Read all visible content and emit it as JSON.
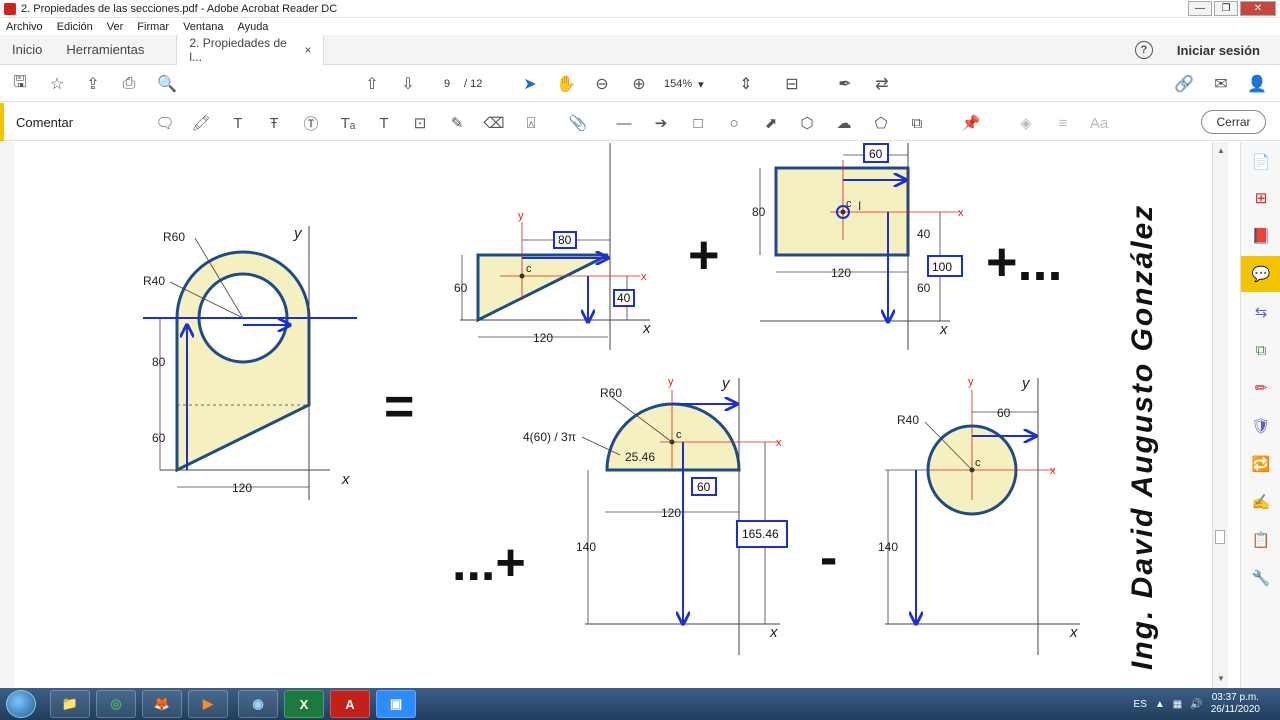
{
  "window": {
    "title": "2. Propiedades de las secciones.pdf - Adobe Acrobat Reader DC",
    "min": "—",
    "max": "❐",
    "close": "✕"
  },
  "menu": [
    "Archivo",
    "Edición",
    "Ver",
    "Firmar",
    "Ventana",
    "Ayuda"
  ],
  "tabs": {
    "home": "Inicio",
    "tools": "Herramientas",
    "document": "2. Propiedades de l...",
    "document_close": "×"
  },
  "header": {
    "signin": "Iniciar sesión",
    "help": "?"
  },
  "toolbar": {
    "page_current": "9",
    "page_total": "/ 12",
    "zoom": "154%",
    "zoom_caret": "▾",
    "icons": {
      "save": "🖫",
      "bookmark": "☆",
      "upload": "⇪",
      "print": "⎙",
      "search": "🔍",
      "prev_page": "⇧",
      "next_page": "⇩",
      "select": "➤",
      "hand": "✋",
      "zoom_out": "⊖",
      "zoom_in": "⊕",
      "fit": "⇕",
      "scroll_mode": "⊟",
      "sign": "✒",
      "share": "⇄",
      "link": "🔗",
      "mail": "✉",
      "user": "👤"
    }
  },
  "comment_bar": {
    "label": "Comentar",
    "close": "Cerrar",
    "icons": {
      "note": "🗨",
      "highlight": "🖍",
      "text": "T",
      "strike": "Ŧ",
      "replace": "Ⓣ",
      "insert": "Tₐ",
      "add_text": "T",
      "textbox": "⊡",
      "pencil": "✎",
      "eraser": "⌫",
      "stamp": "⍓",
      "attach": "📎",
      "line": "—",
      "arrow": "➔",
      "rect": "□",
      "oval": "○",
      "callout": "⬈",
      "polygon": "⬡",
      "cloud": "☁",
      "polyline": "⬠",
      "group": "⧉",
      "pin": "📌",
      "fill": "◈",
      "lines": "≡",
      "font": "Aa"
    }
  },
  "drawing": {
    "left_figure": {
      "r60": "R60",
      "r40": "R40",
      "dim80": "80",
      "dim60": "60",
      "dim120": "120",
      "y": "y",
      "x": "x"
    },
    "equals": "=",
    "triangle": {
      "y": "y",
      "c": "c",
      "x": "x",
      "dim80": "80",
      "dim40": "40",
      "dim60": "60",
      "dim120": "120",
      "xaxis": "x"
    },
    "plus1": "+",
    "rect": {
      "dim60": "60",
      "c": "c",
      "cursor": "I",
      "x": "x",
      "dim80": "80",
      "dim40": "40",
      "dim100": "100",
      "dim120": "120",
      "dim60b": "60",
      "xaxis": "x"
    },
    "plus_dots": "+...",
    "semicircle": {
      "r60": "R60",
      "y": "y",
      "yaxis": "y",
      "formula": "4(60) / 3π",
      "c": "c",
      "x": "x",
      "d2546": "25.46",
      "dim60": "60",
      "dim120": "120",
      "dim140": "140",
      "d16546": "165.46",
      "xaxis": "x"
    },
    "dots_plus": "...+",
    "minus": "-",
    "circle": {
      "y": "y",
      "yaxis": "y",
      "r40": "R40",
      "dim60": "60",
      "c": "c",
      "x": "x",
      "dim140": "140",
      "xaxis": "x"
    },
    "author": "Ing. David Augusto González"
  },
  "colors": {
    "fill": "#f5f0c0",
    "outline": "#1d4c8a",
    "arrow": "#1a2fd6",
    "axis_red": "#e0201c",
    "accent": "#f5c400"
  },
  "right_panel": {
    "icons": [
      "📄",
      "⊞",
      "📕",
      "💬",
      "⇆",
      "⧉",
      "✏",
      "🛡",
      "🔁",
      "✍",
      "📋",
      "🔧"
    ]
  },
  "taskbar": {
    "apps": {
      "explorer": "📁",
      "chrome": "◎",
      "firefox": "🦊",
      "media": "▶",
      "camera": "◉",
      "excel": "X",
      "acrobat": "A",
      "zoom": "▣"
    },
    "lang": "ES",
    "time": "03:37 p.m.",
    "date": "26/11/2020"
  }
}
